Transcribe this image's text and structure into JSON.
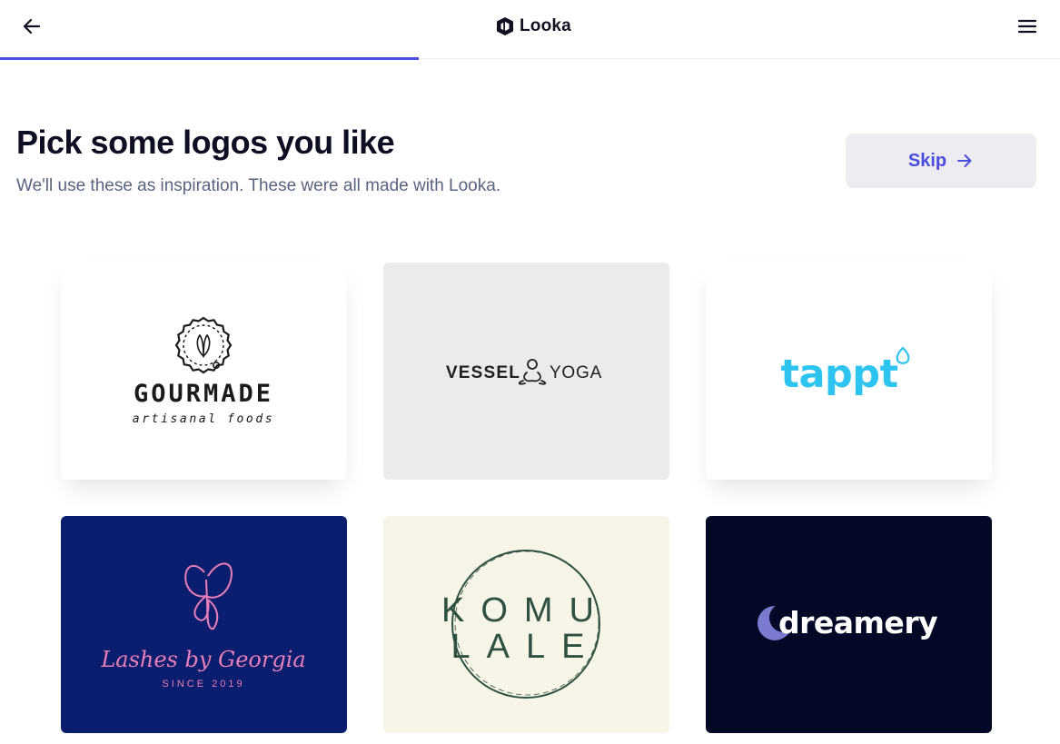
{
  "header": {
    "brand_name": "Looka",
    "progress_fraction": 0.395
  },
  "intro": {
    "title": "Pick some logos you like",
    "subtitle": "We'll use these as inspiration. These were all made with Looka."
  },
  "skip_button": {
    "label": "Skip"
  },
  "colors": {
    "accent": "#4b4de0",
    "title": "#0e0e23",
    "subtitle": "#5a6480"
  },
  "logos": [
    {
      "id": "gourmade",
      "name": "GOURMADE",
      "tagline": "artisanal foods",
      "background": "#ffffff"
    },
    {
      "id": "vessel-yoga",
      "left": "VESSEL",
      "right": "YOGA",
      "background": "#ebebeb"
    },
    {
      "id": "tappt",
      "name": "tappt",
      "background": "#ffffff",
      "color": "#2ec4f0"
    },
    {
      "id": "lashes",
      "script": "Lashes by Georgia",
      "since": "SINCE 2019",
      "background": "#0b1d6e",
      "color": "#e77fb8"
    },
    {
      "id": "komulale",
      "line1": "KOMU",
      "line2": "LALE",
      "background": "#f6f5e8",
      "color": "#2f5240"
    },
    {
      "id": "dreamery",
      "name": "dreamery",
      "background": "#030826"
    }
  ]
}
